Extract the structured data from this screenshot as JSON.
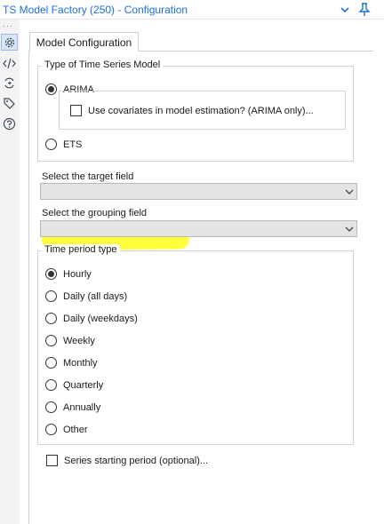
{
  "window": {
    "title": "TS Model Factory (250) - Configuration"
  },
  "rail": {
    "icons": [
      "gear-icon",
      "code-icon",
      "connection-icon",
      "tag-icon",
      "help-icon"
    ],
    "active": "gear-icon"
  },
  "tab": {
    "label": "Model Configuration"
  },
  "model_type": {
    "legend": "Type of Time Series Model",
    "options": [
      {
        "label": "ARIMA",
        "checked": true
      },
      {
        "label": "ETS",
        "checked": false
      }
    ],
    "covariates_label": "Use covariates in model estimation? (ARIMA only)...",
    "covariates_checked": false
  },
  "target_field": {
    "label": "Select the target field",
    "value": ""
  },
  "grouping_field": {
    "label": "Select the grouping field",
    "value": "",
    "highlighted": true
  },
  "time_period": {
    "legend": "Time period type",
    "options": [
      {
        "label": "Hourly",
        "checked": true
      },
      {
        "label": "Daily (all days)",
        "checked": false
      },
      {
        "label": "Daily (weekdays)",
        "checked": false
      },
      {
        "label": "Weekly",
        "checked": false
      },
      {
        "label": "Monthly",
        "checked": false
      },
      {
        "label": "Quarterly",
        "checked": false
      },
      {
        "label": "Annually",
        "checked": false
      },
      {
        "label": "Other",
        "checked": false
      }
    ]
  },
  "series_start": {
    "label": "Series starting period (optional)...",
    "checked": false
  },
  "colors": {
    "accent": "#1d6fd8",
    "highlight": "#ffff3a",
    "select_bg": "#e4e4e4"
  }
}
